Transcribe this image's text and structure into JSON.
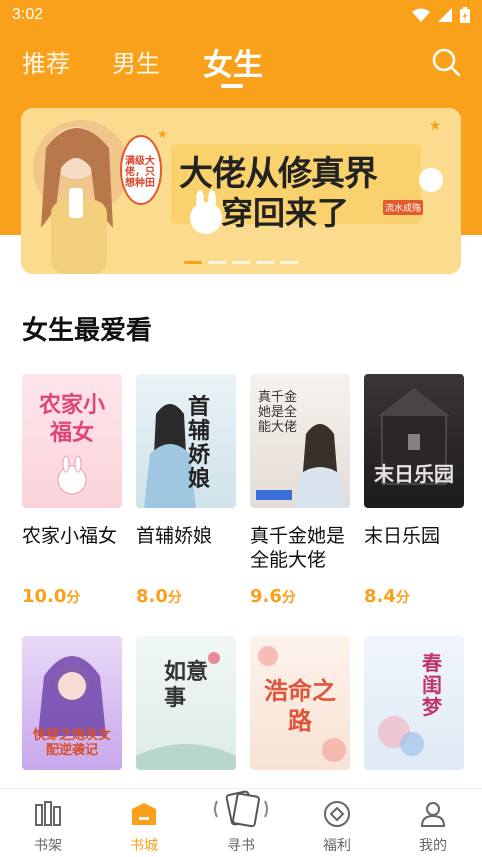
{
  "status": {
    "time": "3:02"
  },
  "tabs": [
    {
      "label": "推荐",
      "active": false
    },
    {
      "label": "男生",
      "active": false
    },
    {
      "label": "女生",
      "active": true
    }
  ],
  "banner": {
    "title_line1": "大佬从修真界",
    "title_line2": "穿回来了",
    "author": "流水成殇",
    "bubble": "满级大佬，只想种田",
    "dots": 5,
    "active_dot": 0
  },
  "section": {
    "title": "女生最爱看"
  },
  "books_row1": [
    {
      "title": "农家小福女",
      "score": "10.0",
      "unit": "分",
      "cover_text": "农家小福女"
    },
    {
      "title": "首辅娇娘",
      "score": "8.0",
      "unit": "分",
      "cover_text": "首辅娇娘"
    },
    {
      "title": "真千金她是全能大佬",
      "score": "9.6",
      "unit": "分",
      "cover_text": "真千金她是全能大佬"
    },
    {
      "title": "末日乐园",
      "score": "8.4",
      "unit": "分",
      "cover_text": "末日乐园"
    }
  ],
  "books_row2": [
    {
      "cover_text": "快穿之炮灰女配逆袭记"
    },
    {
      "cover_text": "如意事"
    },
    {
      "cover_text": "浩命之路"
    },
    {
      "cover_text": "春闺梦"
    }
  ],
  "bottom_nav": [
    {
      "label": "书架",
      "icon": "bookshelf-icon",
      "active": false
    },
    {
      "label": "书城",
      "icon": "bookstore-icon",
      "active": true
    },
    {
      "label": "寻书",
      "icon": "find-book-icon",
      "active": false
    },
    {
      "label": "福利",
      "icon": "welfare-icon",
      "active": false
    },
    {
      "label": "我的",
      "icon": "profile-icon",
      "active": false
    }
  ],
  "colors": {
    "accent": "#f9a11b"
  }
}
